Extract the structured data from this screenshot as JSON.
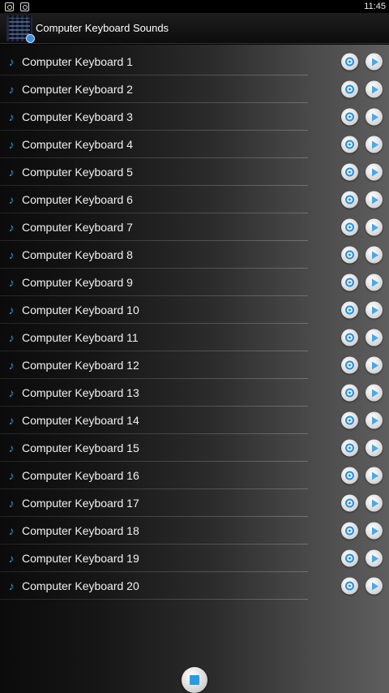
{
  "status_bar": {
    "time": "11:45",
    "icons": [
      "screenshot-icon",
      "gallery-icon"
    ]
  },
  "app": {
    "title": "Computer Keyboard Sounds",
    "icon": "app-icon"
  },
  "sounds": [
    "Computer Keyboard 1",
    "Computer Keyboard 2",
    "Computer Keyboard 3",
    "Computer Keyboard 4",
    "Computer Keyboard 5",
    "Computer Keyboard 6",
    "Computer Keyboard 7",
    "Computer Keyboard 8",
    "Computer Keyboard 9",
    "Computer Keyboard 10",
    "Computer Keyboard 11",
    "Computer Keyboard 12",
    "Computer Keyboard 13",
    "Computer Keyboard 14",
    "Computer Keyboard 15",
    "Computer Keyboard 16",
    "Computer Keyboard 17",
    "Computer Keyboard 18",
    "Computer Keyboard 19",
    "Computer Keyboard 20"
  ],
  "colors": {
    "accent": "#2a9be0"
  }
}
